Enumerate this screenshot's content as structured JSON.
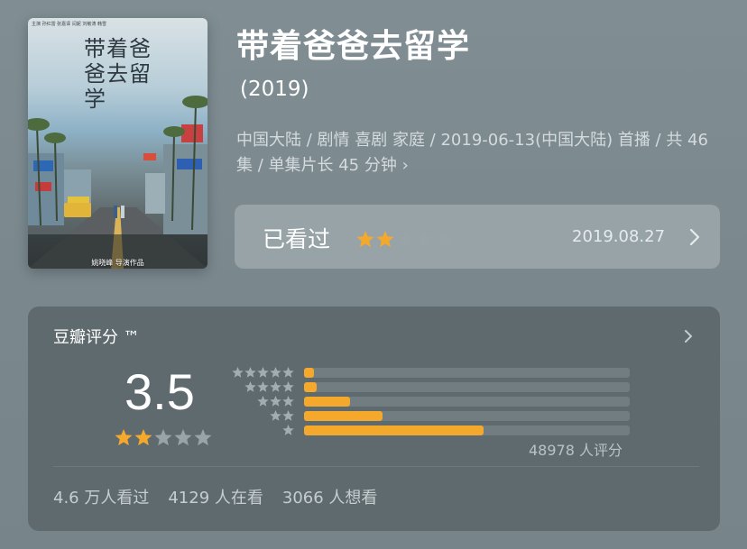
{
  "movie": {
    "title": "带着爸爸去留学",
    "year": "(2019)",
    "meta": "中国大陆 / 剧情 喜剧 家庭 / 2019-06-13(中国大陆) 首播 / 共 46 集 / 单集片长 45 分钟 ›",
    "poster": {
      "title": "带着爸爸去留学",
      "credits": "主演  孙红雷  张嘉译  闫妮  刘敏涛  韩雪",
      "subtitle": "姚晓峰  导演作品"
    }
  },
  "watched": {
    "label": "已看过",
    "stars": 2,
    "date": "2019.08.27"
  },
  "rating": {
    "title": "豆瓣评分 ™",
    "score": "3.5",
    "score_stars": 2,
    "max_stars": 5,
    "distribution": [
      {
        "stars": 5,
        "fraction": 0.03
      },
      {
        "stars": 4,
        "fraction": 0.04
      },
      {
        "stars": 3,
        "fraction": 0.14
      },
      {
        "stars": 2,
        "fraction": 0.24
      },
      {
        "stars": 1,
        "fraction": 0.55
      }
    ],
    "count": "48978 人评分",
    "stats": [
      "4.6 万人看过",
      "4129 人在看",
      "3066 人想看"
    ]
  },
  "colors": {
    "star_filled": "#f4a92c",
    "star_empty": "#9aa4a8",
    "bar_fill": "#f4a92c"
  }
}
